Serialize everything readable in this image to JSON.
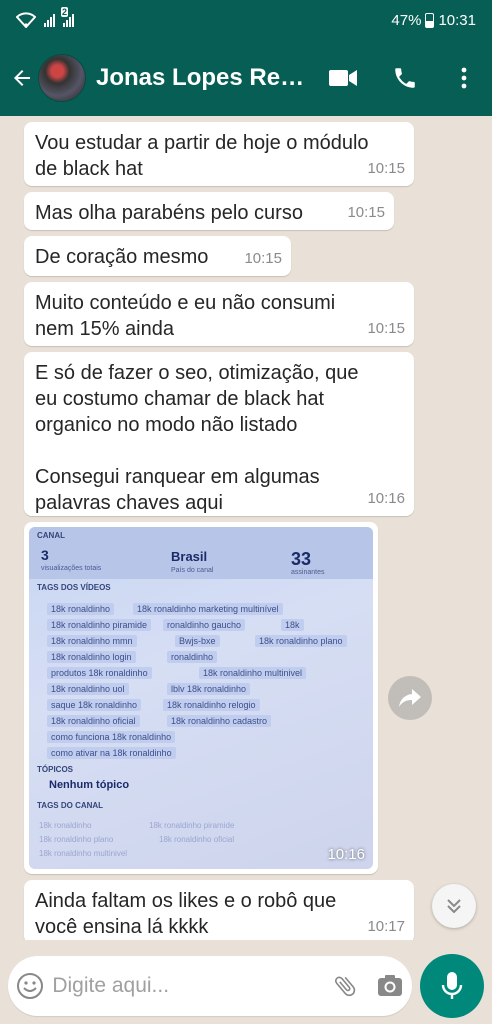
{
  "status_bar": {
    "sim2_badge": "2",
    "battery": "47%",
    "time": "10:31"
  },
  "header": {
    "contact_name": "Jonas Lopes Rei...",
    "icons": [
      "back-arrow-icon",
      "video-call-icon",
      "phone-icon",
      "more-options-icon"
    ]
  },
  "messages": [
    {
      "text": "Vou estudar a partir de hoje o módulo\nde black hat",
      "time": "10:15"
    },
    {
      "text": "Mas olha parabéns pelo curso",
      "time": "10:15"
    },
    {
      "text": "De coração mesmo",
      "time": "10:15"
    },
    {
      "text": "Muito conteúdo e eu não consumi\nnem 15% ainda",
      "time": "10:15"
    },
    {
      "text": "E só de fazer o seo, otimização, que\neu costumo chamar de black hat\norganico no modo não listado\n\nConsegui ranquear em algumas\npalavras chaves aqui",
      "time": "10:16"
    },
    {
      "text": "Ainda faltam os likes e o robô que\nvocê ensina lá kkkk",
      "time": "10:17"
    }
  ],
  "image_message": {
    "time": "10:16",
    "screenshot": {
      "header_label": "CANAL",
      "views": "3",
      "views_label": "visualizações totais",
      "country": "Brasil",
      "country_label": "País do canal",
      "subscribers": "33",
      "subscribers_label": "assinantes",
      "tags_title": "TAGS DOS VÍDEOS",
      "tags": [
        "18k ronaldinho",
        "18k ronaldinho marketing multinível",
        "18k ronaldinho piramide",
        "ronaldinho gaucho",
        "18k",
        "18k ronaldinho mmn",
        "Bwjs-bxe",
        "18k ronaldinho plano",
        "18k ronaldinho login",
        "ronaldinho",
        "produtos 18k ronaldinho",
        "18k ronaldinho multinivel",
        "18k ronaldinho uol",
        "lblv 18k ronaldinho",
        "saque 18k ronaldinho",
        "18k ronaldinho relogio",
        "18k ronaldinho oficial",
        "18k ronaldinho cadastro",
        "como funciona 18k ronaldinho",
        "como ativar na 18k ronaldinho"
      ],
      "topics_title": "TÓPICOS",
      "topics_value": "Nenhum tópico",
      "channel_tags_title": "TAGS DO CANAL"
    }
  },
  "composer": {
    "placeholder": "Digite aqui...",
    "icons": [
      "emoji-icon",
      "attach-icon",
      "camera-icon",
      "mic-icon"
    ]
  },
  "colors": {
    "header": "#075e54",
    "mic_button": "#00897b",
    "chat_background": "#e9e1d7"
  }
}
